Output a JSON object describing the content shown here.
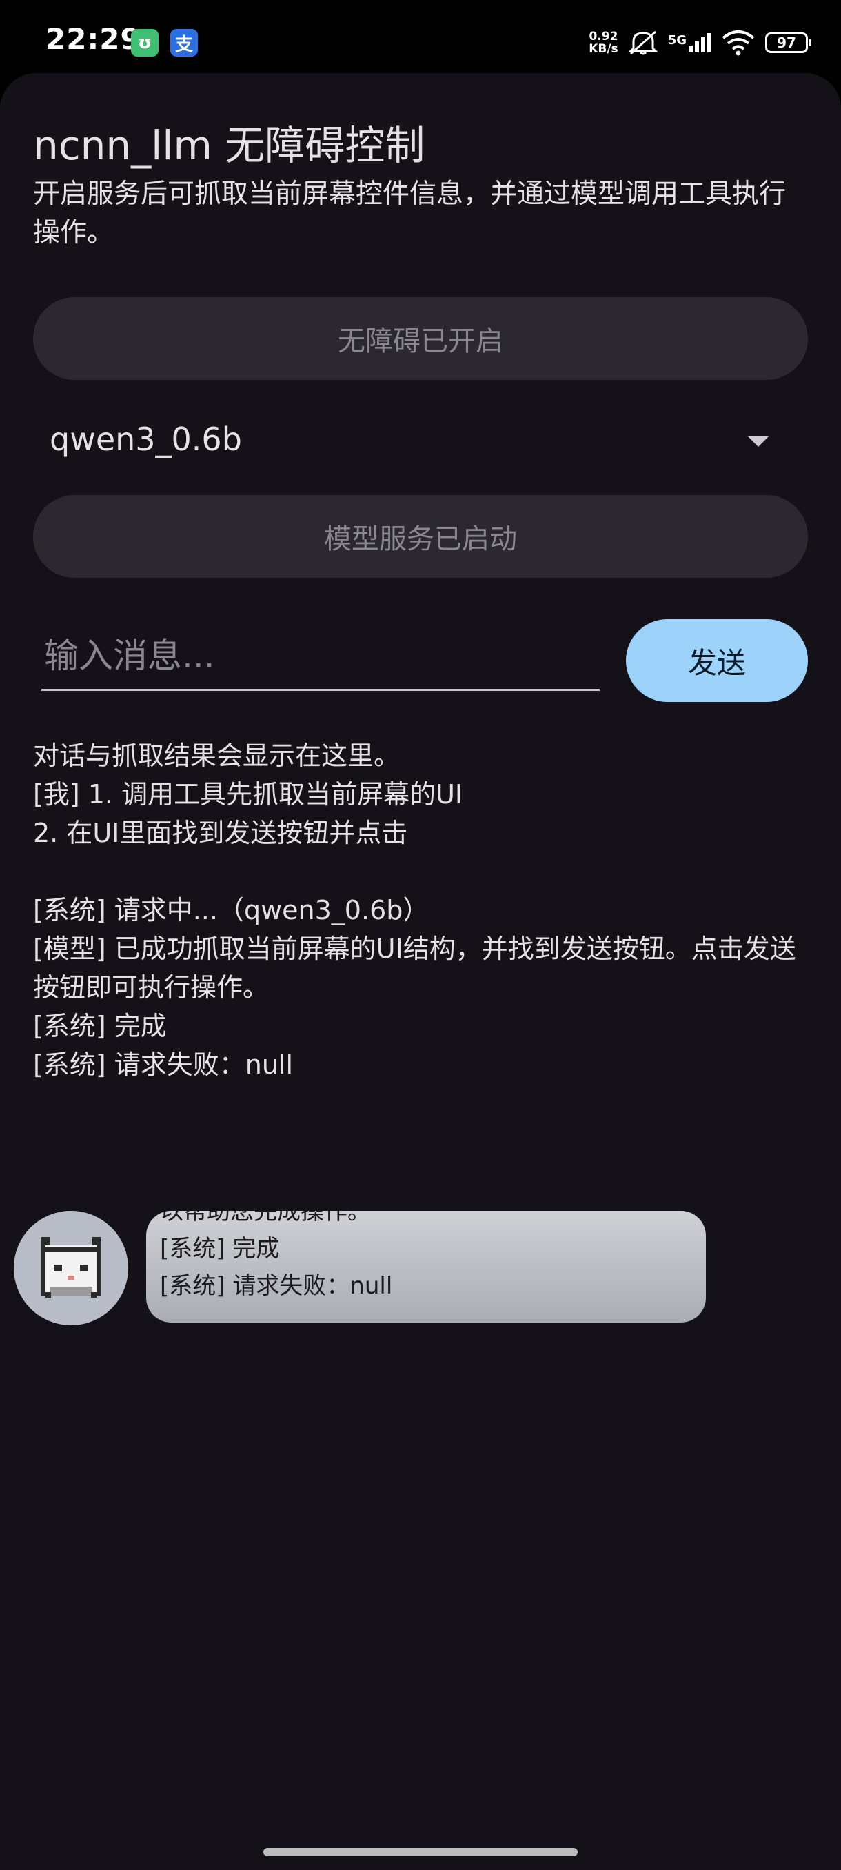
{
  "status_bar": {
    "time": "22:29",
    "app_icons": [
      "mi-home-icon",
      "alipay-icon"
    ],
    "mi_glyph": "ʊ",
    "alipay_glyph": "支",
    "net_speed_value": "0.92",
    "net_speed_unit": "KB/s",
    "network_type": "5G",
    "battery": "97"
  },
  "header": {
    "title": "ncnn_llm 无障碍控制",
    "description": "开启服务后可抓取当前屏幕控件信息，并通过模型调用工具执行操作。"
  },
  "accessibility_button": {
    "label": "无障碍已开启"
  },
  "model_select": {
    "value": "qwen3_0.6b"
  },
  "model_button": {
    "label": "模型服务已启动"
  },
  "composer": {
    "placeholder": "输入消息...",
    "value": "",
    "send_label": "发送"
  },
  "log": {
    "lines": [
      "对话与抓取结果会显示在这里。",
      "[我] 1. 调用工具先抓取当前屏幕的UI",
      "2. 在UI里面找到发送按钮并点击",
      "",
      "[系统] 请求中...（qwen3_0.6b）",
      "[模型] 已成功抓取当前屏幕的UI结构，并找到发送按钮。点击发送按钮即可执行操作。",
      "[系统] 完成",
      "[系统] 请求失败：null"
    ]
  },
  "floating_widget": {
    "bubble_lines": [
      "以帮助您完成操作。",
      "[系统] 完成",
      "[系统] 请求失败：null"
    ]
  },
  "colors": {
    "background": "#141218",
    "pill": "#2b292f",
    "send_button": "#9dd3fa",
    "text": "#e6e1e5"
  }
}
